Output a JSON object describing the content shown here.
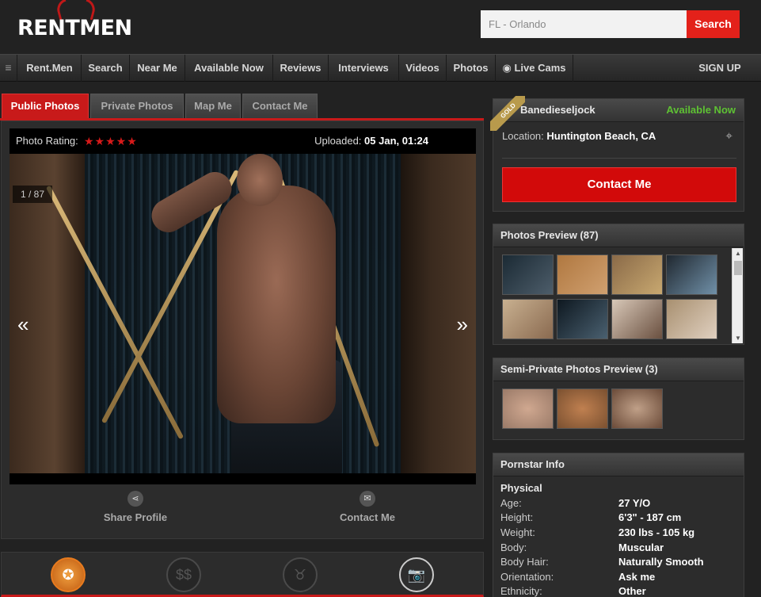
{
  "header": {
    "logo_text": "RENTMEN",
    "search_placeholder": "FL - Orlando",
    "search_button": "Search"
  },
  "nav": {
    "menu_icon": "hamburger-icon",
    "items": [
      "Rent.Men",
      "Search",
      "Near Me",
      "Available Now",
      "Reviews",
      "Interviews",
      "Videos",
      "Photos",
      "Live Cams"
    ],
    "live_cams_icon": "webcam-icon",
    "signup": "SIGN UP"
  },
  "tabs": [
    "Public Photos",
    "Private Photos",
    "Map Me",
    "Contact Me"
  ],
  "photo": {
    "rating_label": "Photo Rating:",
    "stars": "★★★★★",
    "uploaded_label": "Uploaded:",
    "uploaded_value": "05 Jan, 01:24",
    "counter": "1 / 87",
    "prev": "«",
    "next": "»"
  },
  "actions": {
    "share": "Share Profile",
    "contact": "Contact Me"
  },
  "profile": {
    "badge": "GOLD",
    "username": "Banedieseljock",
    "availability": "Available Now",
    "location_label": "Location:",
    "location_value": "Huntington Beach, CA",
    "contact_button": "Contact Me"
  },
  "photos_preview": {
    "title": "Photos Preview (87)"
  },
  "semi_private": {
    "title": "Semi-Private Photos Preview (3)"
  },
  "info": {
    "title": "Pornstar Info",
    "section": "Physical",
    "rows": [
      {
        "k": "Age:",
        "v": "27 Y/O"
      },
      {
        "k": "Height:",
        "v": "6'3\" - 187 cm"
      },
      {
        "k": "Weight:",
        "v": "230 lbs - 105 kg"
      },
      {
        "k": "Body:",
        "v": "Muscular"
      },
      {
        "k": "Body Hair:",
        "v": "Naturally Smooth"
      },
      {
        "k": "Orientation:",
        "v": "Ask me"
      },
      {
        "k": "Ethnicity:",
        "v": "Other"
      }
    ]
  },
  "colors": {
    "accent": "#c81a1a",
    "available": "#5ec133",
    "gold": "#b89a4c"
  }
}
